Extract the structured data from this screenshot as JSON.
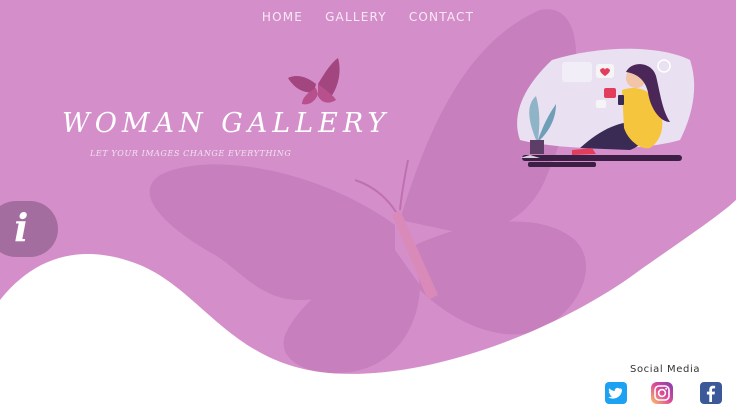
{
  "nav": {
    "home": "HOME",
    "gallery": "GALLERY",
    "contact": "CONTACT"
  },
  "hero": {
    "title": "WOMAN GALLERY",
    "tagline": "LET YOUR IMAGES CHANGE EVERYTHING"
  },
  "info_button": {
    "label": "i"
  },
  "social": {
    "title": "Social Media",
    "icons": [
      "twitter-icon",
      "instagram-icon",
      "facebook-icon"
    ]
  },
  "colors": {
    "background": "#d48fcb",
    "butterfly": "#c77fbd",
    "accent_butterfly": "#a3457f",
    "info_button": "#a46da0",
    "twitter": "#1da1f2",
    "facebook": "#3b5998"
  }
}
